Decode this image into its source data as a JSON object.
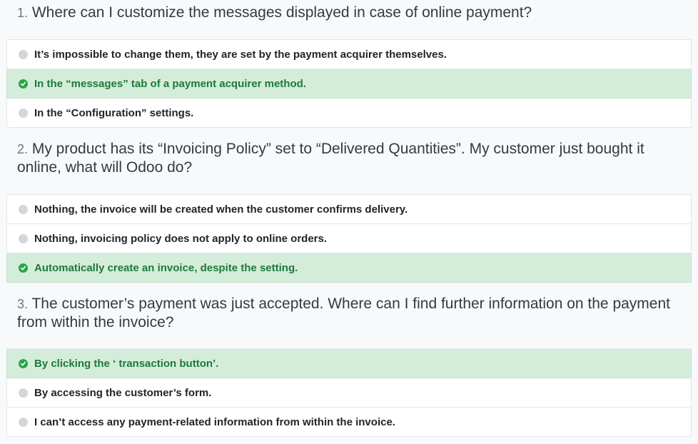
{
  "questions": [
    {
      "number": "1.",
      "title": "Where can I customize the messages displayed in case of online payment?",
      "answers": [
        {
          "label": "It’s impossible to change them, they are set by the payment acquirer themselves.",
          "correct": false
        },
        {
          "label": "In the “messages” tab of a payment acquirer method.",
          "correct": true
        },
        {
          "label": "In the “Configuration” settings.",
          "correct": false
        }
      ]
    },
    {
      "number": "2.",
      "title": "My product has its “Invoicing Policy” set to “Delivered Quantities”. My customer just bought it online, what will Odoo do?",
      "answers": [
        {
          "label": "Nothing, the invoice will be created when the customer confirms delivery.",
          "correct": false
        },
        {
          "label": "Nothing, invoicing policy does not apply to online orders.",
          "correct": false
        },
        {
          "label": "Automatically create an invoice, despite the setting.",
          "correct": true
        }
      ]
    },
    {
      "number": "3.",
      "title": "The customer’s payment was just accepted. Where can I find further information on the payment from within the invoice?",
      "answers": [
        {
          "label": "By clicking the ‘ transaction button’.",
          "correct": true
        },
        {
          "label": "By accessing the customer’s form.",
          "correct": false
        },
        {
          "label": "I can’t access any payment-related information from within the invoice.",
          "correct": false
        }
      ]
    }
  ],
  "colors": {
    "correct_bg": "#d4eddb",
    "correct_text": "#1e7a38",
    "correct_icon": "#28a745",
    "neutral_dot": "#d3d6da"
  }
}
